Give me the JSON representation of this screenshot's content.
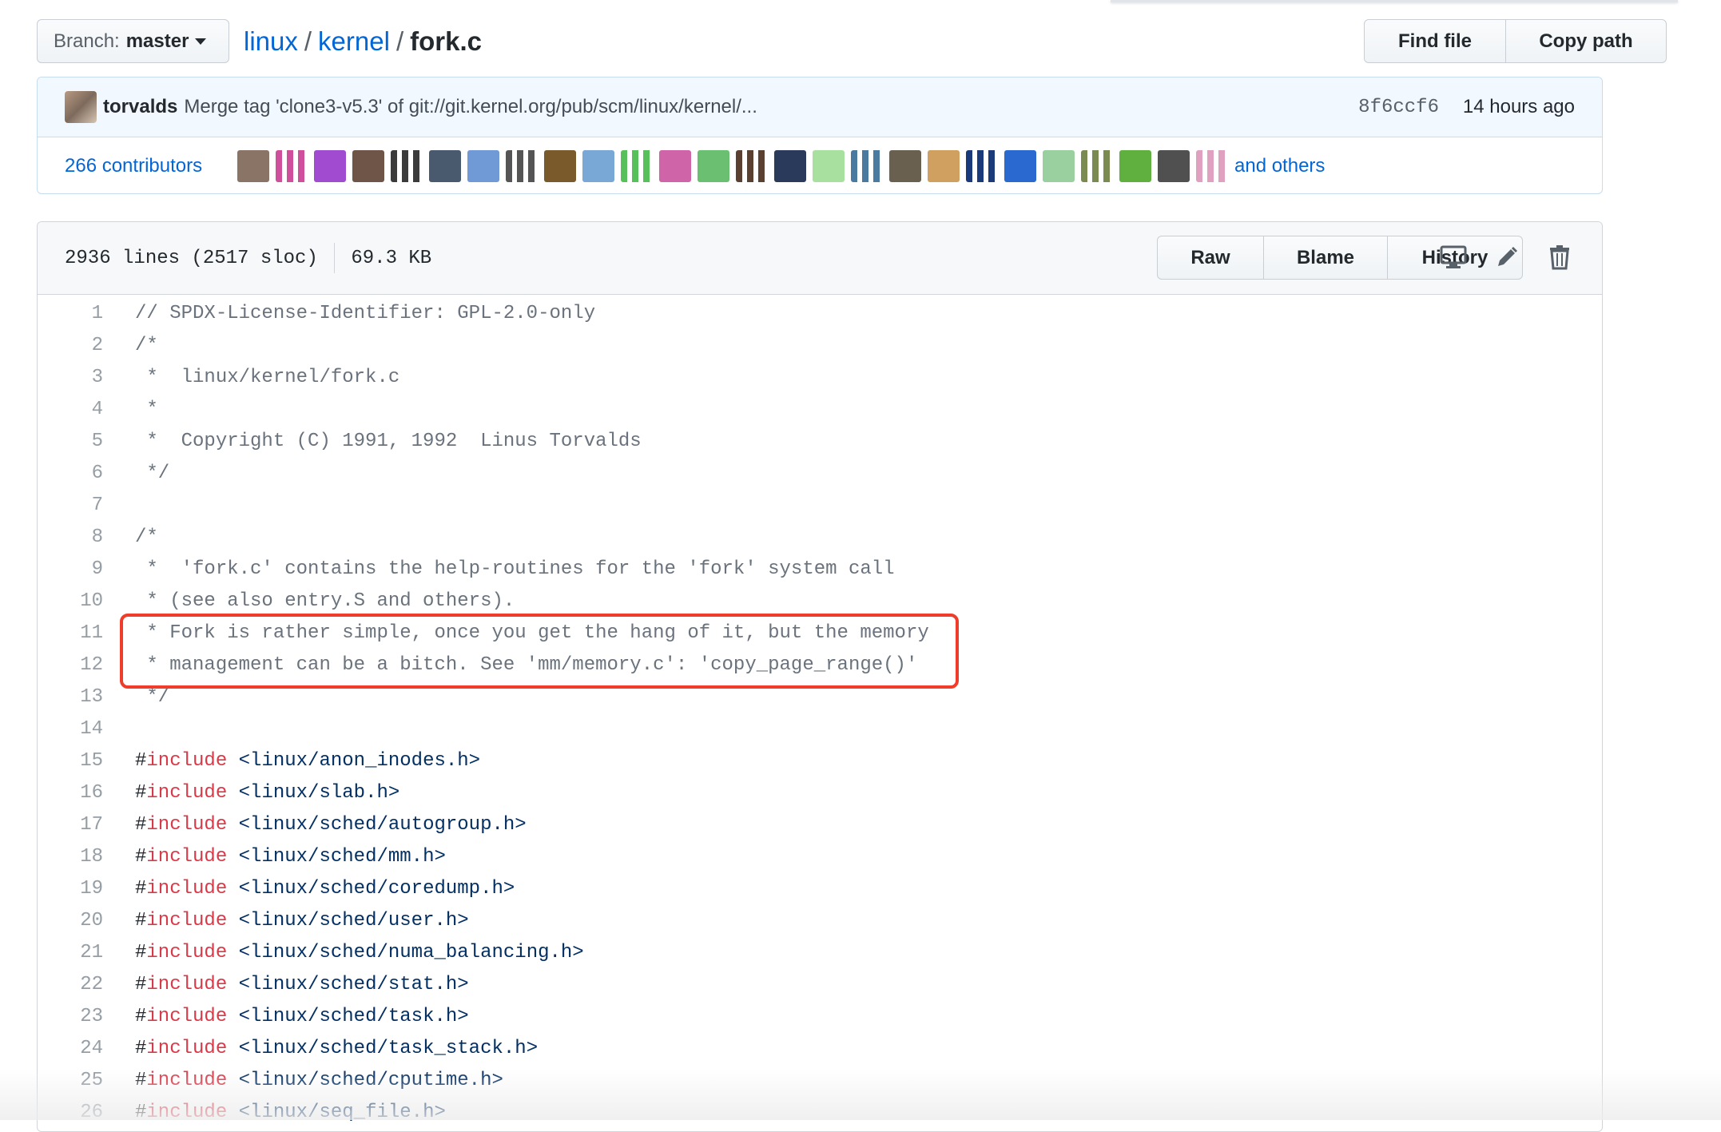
{
  "branch": {
    "label": "Branch:",
    "value": "master"
  },
  "breadcrumb": {
    "repo": "linux",
    "dir": "kernel",
    "file": "fork.c",
    "sep": "/"
  },
  "file_actions": {
    "find_file": "Find file",
    "copy_path": "Copy path"
  },
  "commit": {
    "author": "torvalds",
    "message": "Merge tag 'clone3-v5.3' of git://git.kernel.org/pub/scm/linux/kernel/...",
    "sha": "8f6ccf6",
    "time": "14 hours ago"
  },
  "contributors": {
    "count_label": "266 contributors",
    "and_others": "and others",
    "avatar_colors": [
      "#8a7466",
      "#d04f9d",
      "#a04bd0",
      "#6e5548",
      "#3b3b3b",
      "#4a5a6e",
      "#6f9ad6",
      "#555555",
      "#7a5a2a",
      "#7aa8d6",
      "#58c05a",
      "#d064a8",
      "#6ac070",
      "#5a4030",
      "#2a3a5a",
      "#a8e0a0",
      "#4a7aa0",
      "#6a6050",
      "#d0a060",
      "#1a3a7a",
      "#2a6ad0",
      "#9ad0a0",
      "#7a8a50",
      "#60b040",
      "#505050",
      "#e0a0c0"
    ]
  },
  "file_meta": {
    "lines": "2936 lines (2517 sloc)",
    "size": "69.3 KB"
  },
  "file_buttons": {
    "raw": "Raw",
    "blame": "Blame",
    "history": "History"
  },
  "code_lines": [
    {
      "n": "1",
      "t": "// SPDX-License-Identifier: GPL-2.0-only"
    },
    {
      "n": "2",
      "t": "/*"
    },
    {
      "n": "3",
      "t": " *  linux/kernel/fork.c"
    },
    {
      "n": "4",
      "t": " *"
    },
    {
      "n": "5",
      "t": " *  Copyright (C) 1991, 1992  Linus Torvalds"
    },
    {
      "n": "6",
      "t": " */"
    },
    {
      "n": "7",
      "t": ""
    },
    {
      "n": "8",
      "t": "/*"
    },
    {
      "n": "9",
      "t": " *  'fork.c' contains the help-routines for the 'fork' system call"
    },
    {
      "n": "10",
      "t": " * (see also entry.S and others)."
    },
    {
      "n": "11",
      "t": " * Fork is rather simple, once you get the hang of it, but the memory"
    },
    {
      "n": "12",
      "t": " * management can be a bitch. See 'mm/memory.c': 'copy_page_range()'"
    },
    {
      "n": "13",
      "t": " */"
    },
    {
      "n": "14",
      "t": ""
    }
  ],
  "include_lines": [
    {
      "n": "15",
      "hash": "#",
      "kw": "include",
      "path": " <linux/anon_inodes.h>"
    },
    {
      "n": "16",
      "hash": "#",
      "kw": "include",
      "path": " <linux/slab.h>"
    },
    {
      "n": "17",
      "hash": "#",
      "kw": "include",
      "path": " <linux/sched/autogroup.h>"
    },
    {
      "n": "18",
      "hash": "#",
      "kw": "include",
      "path": " <linux/sched/mm.h>"
    },
    {
      "n": "19",
      "hash": "#",
      "kw": "include",
      "path": " <linux/sched/coredump.h>"
    },
    {
      "n": "20",
      "hash": "#",
      "kw": "include",
      "path": " <linux/sched/user.h>"
    },
    {
      "n": "21",
      "hash": "#",
      "kw": "include",
      "path": " <linux/sched/numa_balancing.h>"
    },
    {
      "n": "22",
      "hash": "#",
      "kw": "include",
      "path": " <linux/sched/stat.h>"
    },
    {
      "n": "23",
      "hash": "#",
      "kw": "include",
      "path": " <linux/sched/task.h>"
    },
    {
      "n": "24",
      "hash": "#",
      "kw": "include",
      "path": " <linux/sched/task_stack.h>"
    },
    {
      "n": "25",
      "hash": "#",
      "kw": "include",
      "path": " <linux/sched/cputime.h>"
    },
    {
      "n": "26",
      "hash": "#",
      "kw": "include",
      "path": " <linux/seq_file.h>"
    }
  ],
  "colors": {
    "link": "#0366d6",
    "keyword": "#d73a49",
    "string": "#032f62",
    "comment": "#6a737d",
    "highlight": "#f03c2a"
  },
  "icons": {
    "display": "desktop-icon",
    "edit": "pencil-icon",
    "delete": "trash-icon"
  }
}
